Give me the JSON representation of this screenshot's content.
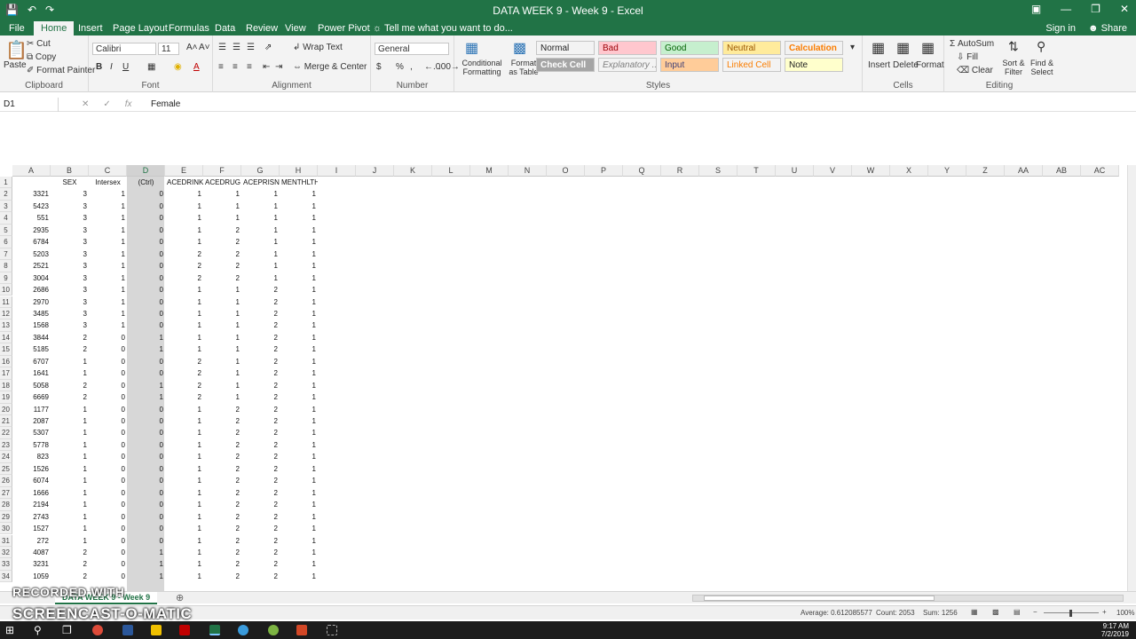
{
  "window": {
    "title": "DATA WEEK 9 - Week 9 - Excel",
    "sign_in": "Sign in",
    "share": "Share"
  },
  "tabs": [
    "File",
    "Home",
    "Insert",
    "Page Layout",
    "Formulas",
    "Data",
    "Review",
    "View",
    "Power Pivot"
  ],
  "tell_me": "Tell me what you want to do...",
  "ribbon": {
    "clipboard": {
      "paste": "Paste",
      "cut": "Cut",
      "copy": "Copy",
      "format_painter": "Format Painter",
      "label": "Clipboard"
    },
    "font": {
      "name": "Calibri",
      "size": "11",
      "label": "Font"
    },
    "alignment": {
      "wrap": "Wrap Text",
      "merge": "Merge & Center",
      "label": "Alignment"
    },
    "number": {
      "format": "General",
      "label": "Number"
    },
    "styles": {
      "conditional": "Conditional Formatting",
      "format_table": "Format as Table",
      "label": "Styles",
      "cells": [
        {
          "name": "Normal",
          "bg": "#ffffff",
          "fg": "#000000"
        },
        {
          "name": "Bad",
          "bg": "#ffc7ce",
          "fg": "#9c0006"
        },
        {
          "name": "Good",
          "bg": "#c6efce",
          "fg": "#006100"
        },
        {
          "name": "Neutral",
          "bg": "#ffeb9c",
          "fg": "#9c5700"
        },
        {
          "name": "Calculation",
          "bg": "#f2f2f2",
          "fg": "#fa7d00"
        },
        {
          "name": "Check Cell",
          "bg": "#a5a5a5",
          "fg": "#ffffff"
        },
        {
          "name": "Explanatory ...",
          "bg": "#ffffff",
          "fg": "#7f7f7f"
        },
        {
          "name": "Input",
          "bg": "#ffcc99",
          "fg": "#3f3f76"
        },
        {
          "name": "Linked Cell",
          "bg": "#ffffff",
          "fg": "#fa7d00"
        },
        {
          "name": "Note",
          "bg": "#ffffcc",
          "fg": "#000000"
        }
      ]
    },
    "cells": {
      "insert": "Insert",
      "delete": "Delete",
      "format": "Format",
      "label": "Cells"
    },
    "editing": {
      "autosum": "AutoSum",
      "fill": "Fill",
      "clear": "Clear",
      "sort": "Sort & Filter",
      "find": "Find & Select",
      "label": "Editing"
    }
  },
  "formula_bar": {
    "name_box": "D1",
    "content": "Female"
  },
  "columns": [
    "A",
    "B",
    "C",
    "D",
    "E",
    "F",
    "G",
    "H",
    "I",
    "J",
    "K",
    "L",
    "M",
    "N",
    "O",
    "P",
    "Q",
    "R",
    "S",
    "T",
    "U",
    "V",
    "W",
    "X",
    "Y",
    "Z",
    "AA",
    "AB",
    "AC"
  ],
  "headers": [
    "",
    "SEX",
    "Intersex",
    "(Ctrl)",
    "ACEDRINK",
    "ACEDRUG",
    "ACEPRISN",
    "MENTHLTH"
  ],
  "rows": [
    [
      "3321",
      "3",
      "1",
      "0",
      "1",
      "1",
      "1",
      "1"
    ],
    [
      "5423",
      "3",
      "1",
      "0",
      "1",
      "1",
      "1",
      "1"
    ],
    [
      "551",
      "3",
      "1",
      "0",
      "1",
      "1",
      "1",
      "1"
    ],
    [
      "2935",
      "3",
      "1",
      "0",
      "1",
      "2",
      "1",
      "1"
    ],
    [
      "6784",
      "3",
      "1",
      "0",
      "1",
      "2",
      "1",
      "1"
    ],
    [
      "5203",
      "3",
      "1",
      "0",
      "2",
      "2",
      "1",
      "1"
    ],
    [
      "2521",
      "3",
      "1",
      "0",
      "2",
      "2",
      "1",
      "1"
    ],
    [
      "3004",
      "3",
      "1",
      "0",
      "2",
      "2",
      "1",
      "1"
    ],
    [
      "2686",
      "3",
      "1",
      "0",
      "1",
      "1",
      "2",
      "1"
    ],
    [
      "2970",
      "3",
      "1",
      "0",
      "1",
      "1",
      "2",
      "1"
    ],
    [
      "3485",
      "3",
      "1",
      "0",
      "1",
      "1",
      "2",
      "1"
    ],
    [
      "1568",
      "3",
      "1",
      "0",
      "1",
      "1",
      "2",
      "1"
    ],
    [
      "3844",
      "2",
      "0",
      "1",
      "1",
      "1",
      "2",
      "1"
    ],
    [
      "5185",
      "2",
      "0",
      "1",
      "1",
      "1",
      "2",
      "1"
    ],
    [
      "6707",
      "1",
      "0",
      "0",
      "2",
      "1",
      "2",
      "1"
    ],
    [
      "1641",
      "1",
      "0",
      "0",
      "2",
      "1",
      "2",
      "1"
    ],
    [
      "5058",
      "2",
      "0",
      "1",
      "2",
      "1",
      "2",
      "1"
    ],
    [
      "6669",
      "2",
      "0",
      "1",
      "2",
      "1",
      "2",
      "1"
    ],
    [
      "1177",
      "1",
      "0",
      "0",
      "1",
      "2",
      "2",
      "1"
    ],
    [
      "2087",
      "1",
      "0",
      "0",
      "1",
      "2",
      "2",
      "1"
    ],
    [
      "5307",
      "1",
      "0",
      "0",
      "1",
      "2",
      "2",
      "1"
    ],
    [
      "5778",
      "1",
      "0",
      "0",
      "1",
      "2",
      "2",
      "1"
    ],
    [
      "823",
      "1",
      "0",
      "0",
      "1",
      "2",
      "2",
      "1"
    ],
    [
      "1526",
      "1",
      "0",
      "0",
      "1",
      "2",
      "2",
      "1"
    ],
    [
      "6074",
      "1",
      "0",
      "0",
      "1",
      "2",
      "2",
      "1"
    ],
    [
      "1666",
      "1",
      "0",
      "0",
      "1",
      "2",
      "2",
      "1"
    ],
    [
      "2194",
      "1",
      "0",
      "0",
      "1",
      "2",
      "2",
      "1"
    ],
    [
      "2743",
      "1",
      "0",
      "0",
      "1",
      "2",
      "2",
      "1"
    ],
    [
      "1527",
      "1",
      "0",
      "0",
      "1",
      "2",
      "2",
      "1"
    ],
    [
      "272",
      "1",
      "0",
      "0",
      "1",
      "2",
      "2",
      "1"
    ],
    [
      "4087",
      "2",
      "0",
      "1",
      "1",
      "2",
      "2",
      "1"
    ],
    [
      "3231",
      "2",
      "0",
      "1",
      "1",
      "2",
      "2",
      "1"
    ],
    [
      "1059",
      "2",
      "0",
      "1",
      "1",
      "2",
      "2",
      "1"
    ]
  ],
  "sheet_tab": "DATA WEEK 9 - Week 9",
  "status": {
    "average": "Average: 0.612085577",
    "count": "Count: 2053",
    "sum": "Sum: 1256",
    "zoom": "100%"
  },
  "watermark": {
    "line1": "RECORDED WITH",
    "line2": "SCREENCAST-O-MATIC"
  },
  "clock": {
    "time": "9:17 AM",
    "date": "7/2/2019"
  }
}
